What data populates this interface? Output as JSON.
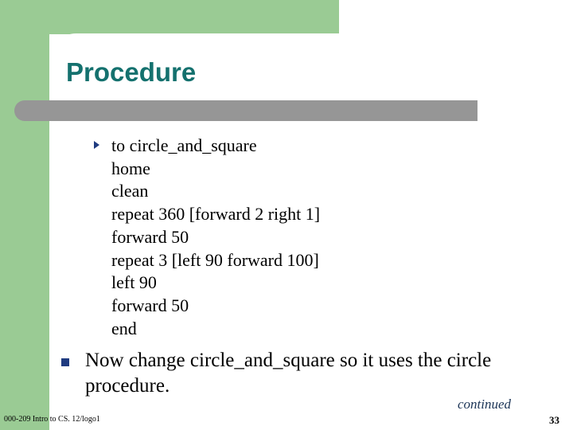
{
  "slide": {
    "title": "Procedure",
    "colors": {
      "green_accent": "#9ACB94",
      "gray_bar": "#969696",
      "title_teal": "#14716E",
      "bullet_navy": "#1F3B80",
      "continued_navy": "#1C3557",
      "body_text": "#000000"
    },
    "code_bullet": {
      "marker": "triangle-bullet",
      "lines": [
        "to circle_and_square",
        "home",
        "clean",
        "repeat 360 [forward 2 right 1]",
        "forward 50",
        "repeat 3 [left 90 forward 100]",
        "left 90",
        "forward 50",
        "end"
      ]
    },
    "note_bullet": {
      "marker": "square-bullet",
      "text": "Now change circle_and_square so it uses the circle procedure."
    },
    "footer": {
      "continued_label": "continued",
      "course_label": "000-209 Intro to CS. 12/logo1",
      "page_number": "33"
    }
  }
}
